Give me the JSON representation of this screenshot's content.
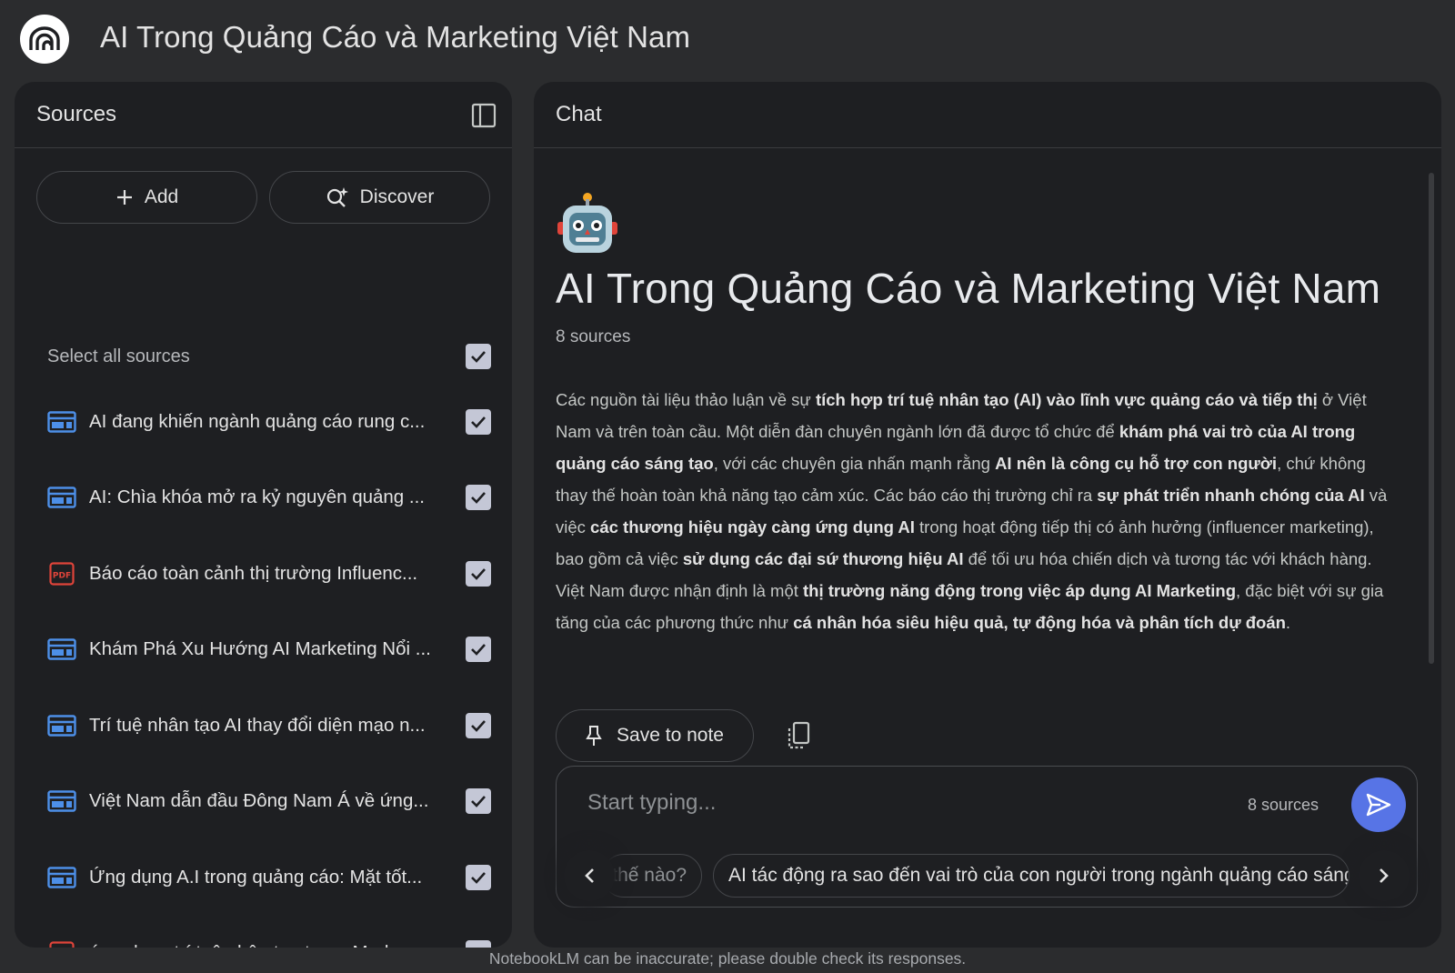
{
  "app": {
    "title": "AI Trong Quảng Cáo và Marketing Việt Nam"
  },
  "sources_panel": {
    "header": "Sources",
    "add_label": "Add",
    "discover_label": "Discover",
    "select_all_label": "Select all sources",
    "items": [
      {
        "type": "web",
        "title": "AI đang khiến ngành quảng cáo rung c...",
        "checked": true
      },
      {
        "type": "web",
        "title": "AI: Chìa khóa mở ra kỷ nguyên quảng ...",
        "checked": true
      },
      {
        "type": "pdf",
        "title": "Báo cáo toàn cảnh thị trường Influenc...",
        "checked": true
      },
      {
        "type": "web",
        "title": "Khám Phá Xu Hướng AI Marketing Nổi ...",
        "checked": true
      },
      {
        "type": "web",
        "title": "Trí tuệ nhân tạo AI thay đổi diện mạo n...",
        "checked": true
      },
      {
        "type": "web",
        "title": "Việt Nam dẫn đầu Đông Nam Á về ứng...",
        "checked": true
      },
      {
        "type": "web",
        "title": "Ứng dụng A.I trong quảng cáo: Mặt tốt...",
        "checked": true
      },
      {
        "type": "pdf",
        "title": "ứng dụng trí tuệ nhân tạo trong Marke...",
        "checked": true
      }
    ]
  },
  "chat_panel": {
    "header": "Chat",
    "notebook_title": "AI Trong Quảng Cáo và Marketing Việt Nam",
    "source_count": "8 sources",
    "summary": [
      {
        "t": "Các nguồn tài liệu thảo luận về sự ",
        "b": false
      },
      {
        "t": "tích hợp trí tuệ nhân tạo (AI) vào lĩnh vực quảng cáo và tiếp thị",
        "b": true
      },
      {
        "t": " ở Việt Nam và trên toàn cầu. Một diễn đàn chuyên ngành lớn đã được tổ chức để ",
        "b": false
      },
      {
        "t": "khám phá vai trò của AI trong quảng cáo sáng tạo",
        "b": true
      },
      {
        "t": ", với các chuyên gia nhấn mạnh rằng ",
        "b": false
      },
      {
        "t": "AI nên là công cụ hỗ trợ con người",
        "b": true
      },
      {
        "t": ", chứ không thay thế hoàn toàn khả năng tạo cảm xúc. Các báo cáo thị trường chỉ ra ",
        "b": false
      },
      {
        "t": "sự phát triển nhanh chóng của AI",
        "b": true
      },
      {
        "t": " và việc ",
        "b": false
      },
      {
        "t": "các thương hiệu ngày càng ứng dụng AI",
        "b": true
      },
      {
        "t": " trong hoạt động tiếp thị có ảnh hưởng (influencer marketing), bao gồm cả việc ",
        "b": false
      },
      {
        "t": "sử dụng các đại sứ thương hiệu AI",
        "b": true
      },
      {
        "t": " để tối ưu hóa chiến dịch và tương tác với khách hàng. Việt Nam được nhận định là một ",
        "b": false
      },
      {
        "t": "thị trường năng động trong việc áp dụng AI Marketing",
        "b": true
      },
      {
        "t": ", đặc biệt với sự gia tăng của các phương thức như ",
        "b": false
      },
      {
        "t": "cá nhân hóa siêu hiệu quả, tự động hóa và phân tích dự đoán",
        "b": true
      },
      {
        "t": ".",
        "b": false
      }
    ],
    "save_to_note_label": "Save to note",
    "composer": {
      "placeholder": "Start typing...",
      "source_count": "8 sources"
    },
    "suggestions": [
      "thế nào?",
      "AI tác động ra sao đến vai trò của con người trong ngành quảng cáo sáng"
    ]
  },
  "footer": {
    "disclaimer": "NotebookLM can be inaccurate; please double check its responses."
  },
  "colors": {
    "background": "#2b2c2e",
    "panel": "#1e1f22",
    "web_icon": "#4d8fe8",
    "pdf_icon": "#e0443a",
    "send_button": "#5774e6"
  }
}
